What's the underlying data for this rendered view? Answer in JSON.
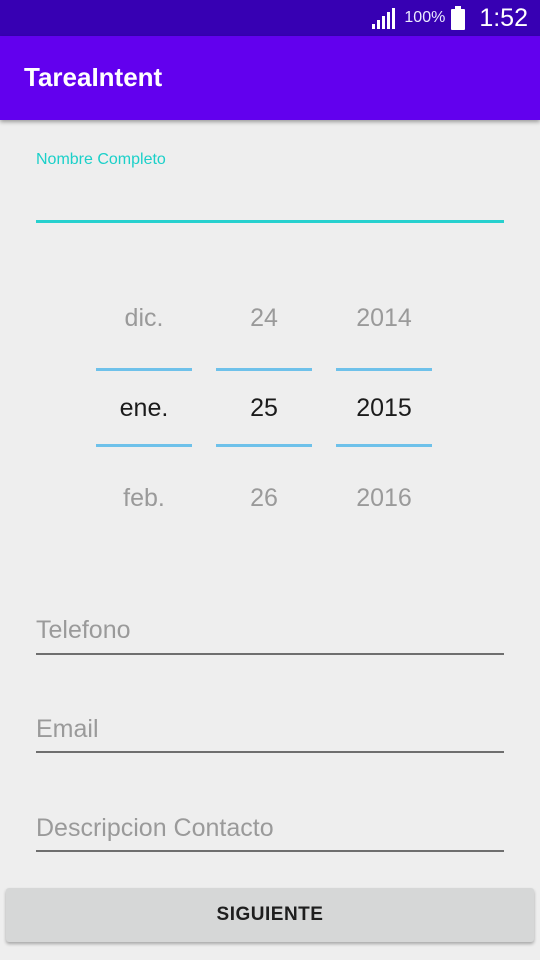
{
  "status_bar": {
    "signal_icon": "signal-icon",
    "battery_percent": "100%",
    "battery_icon": "battery-icon",
    "time": "1:52"
  },
  "app_bar": {
    "title": "TareaIntent"
  },
  "form": {
    "name_field": {
      "label": "Nombre Completo",
      "value": ""
    },
    "date_picker": {
      "month": {
        "prev": "dic.",
        "selected": "ene.",
        "next": "feb."
      },
      "day": {
        "prev": "24",
        "selected": "25",
        "next": "26"
      },
      "year": {
        "prev": "2014",
        "selected": "2015",
        "next": "2016"
      }
    },
    "phone_field": {
      "placeholder": "Telefono"
    },
    "email_field": {
      "placeholder": "Email"
    },
    "description_field": {
      "placeholder": "Descripcion Contacto"
    },
    "next_button": {
      "label": "SIGUIENTE"
    }
  },
  "colors": {
    "status_bar": "#3700b3",
    "app_bar": "#6200ee",
    "accent": "#1bd0c9",
    "picker_divider": "#6ec1ea",
    "background": "#eeeeee"
  }
}
